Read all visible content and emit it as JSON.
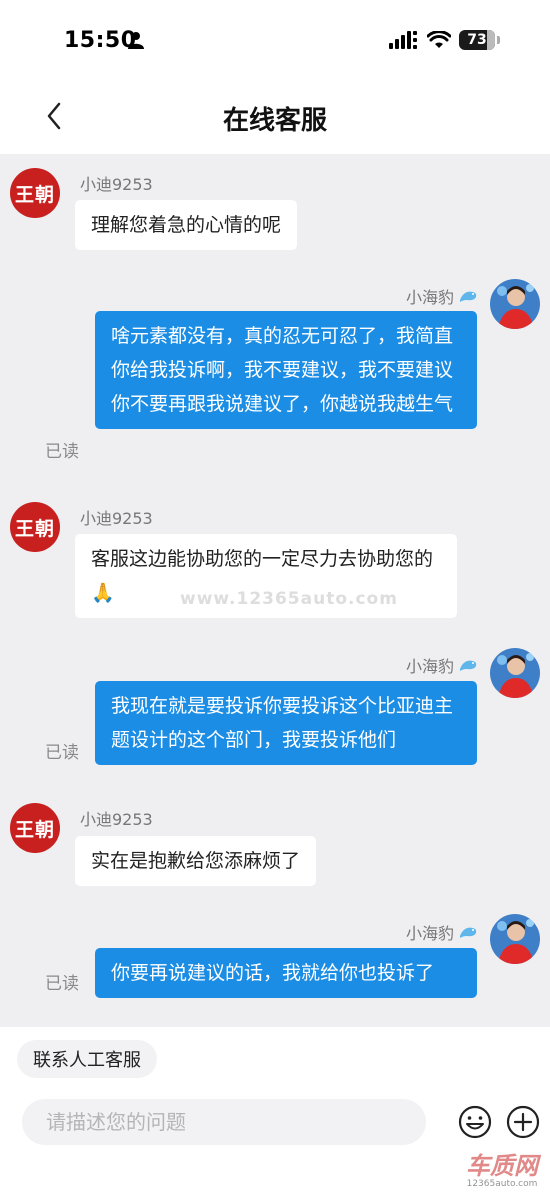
{
  "status_bar": {
    "time": "15:50",
    "battery": "73"
  },
  "header": {
    "title": "在线客服"
  },
  "watermark": "www.12365auto.com",
  "messages": [
    {
      "side": "left",
      "avatar": "王朝",
      "name": "小迪9253",
      "text": "理解您着急的心情的呢"
    },
    {
      "side": "right",
      "name": "小海豹",
      "text": "啥元素都没有，真的忍无可忍了，我简直你给我投诉啊，我不要建议，我不要建议你不要再跟我说建议了，你越说我越生气",
      "read": "已读"
    },
    {
      "side": "left",
      "avatar": "王朝",
      "name": "小迪9253",
      "text": "客服这边能协助您的一定尽力去协助您的🙏"
    },
    {
      "side": "right",
      "name": "小海豹",
      "text": "我现在就是要投诉你要投诉这个比亚迪主题设计的这个部门，我要投诉他们",
      "read": "已读"
    },
    {
      "side": "left",
      "avatar": "王朝",
      "name": "小迪9253",
      "text": "实在是抱歉给您添麻烦了"
    },
    {
      "side": "right",
      "name": "小海豹",
      "text": "你要再说建议的话，我就给你也投诉了",
      "read": "已读"
    }
  ],
  "bottom": {
    "quick_reply": "联系人工客服",
    "input_placeholder": "请描述您的问题",
    "emoji_icon": "emoji-icon",
    "plus_icon": "plus-icon"
  },
  "logo": {
    "big": "车质网",
    "small": "12365auto.com"
  },
  "colors": {
    "accent": "#1b8de4",
    "avatar_red": "#c8201e",
    "chat_bg": "#efeff1"
  }
}
